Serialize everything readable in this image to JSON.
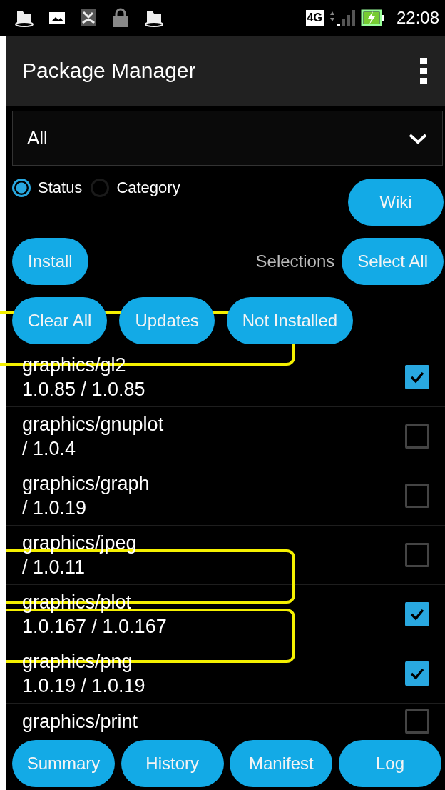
{
  "status_bar": {
    "time": "22:08",
    "network": "4G"
  },
  "app_bar": {
    "title": "Package Manager"
  },
  "filter_dropdown": {
    "value": "All"
  },
  "view_mode": [
    {
      "label": "Status",
      "selected": true
    },
    {
      "label": "Category",
      "selected": false
    }
  ],
  "wiki_button": "Wiki",
  "install_button": "Install",
  "selections_label": "Selections",
  "select_all_button": "Select All",
  "filter_buttons": {
    "highlighted": true,
    "labels": [
      "Clear All",
      "Updates",
      "Not Installed"
    ]
  },
  "packages": [
    {
      "name": "graphics/gl2",
      "version": "1.0.85 / 1.0.85",
      "checked": true
    },
    {
      "name": "graphics/gnuplot",
      "version": " / 1.0.4",
      "checked": false
    },
    {
      "name": "graphics/graph",
      "version": " / 1.0.19",
      "checked": false
    },
    {
      "name": "graphics/jpeg",
      "version": " / 1.0.11",
      "checked": false,
      "highlighted": true
    },
    {
      "name": "graphics/plot",
      "version": "1.0.167 / 1.0.167",
      "checked": true,
      "highlighted": true
    },
    {
      "name": "graphics/png",
      "version": "1.0.19 / 1.0.19",
      "checked": true
    },
    {
      "name": "graphics/print",
      "checked": false
    }
  ],
  "bottom_buttons": [
    "Summary",
    "History",
    "Manifest",
    "Log"
  ]
}
